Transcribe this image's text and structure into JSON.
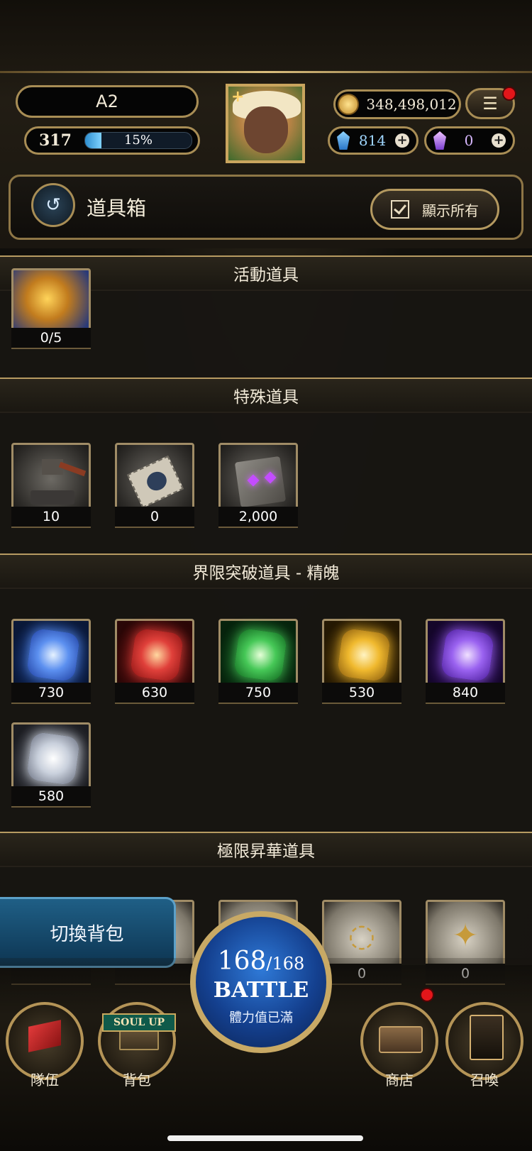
{
  "header": {
    "player_name": "A2",
    "level": "317",
    "exp_percent_label": "15%",
    "exp_fraction": 0.15,
    "gold": "348,498,012",
    "blue_gems": "814",
    "purple_gems": "0",
    "menu_icon": "☰",
    "plus": "+"
  },
  "title_bar": {
    "back_icon": "↺",
    "title": "道具箱",
    "show_all_label": "顯示所有"
  },
  "sections": {
    "event": {
      "title": "活動道具",
      "items": [
        {
          "count": "0/5",
          "icon": "golden-star-orb-icon"
        }
      ]
    },
    "special": {
      "title": "特殊道具",
      "items": [
        {
          "count": "10",
          "icon": "hammer-anvil-icon"
        },
        {
          "count": "0",
          "icon": "ticket-icon"
        },
        {
          "count": "2,000",
          "icon": "stone-cube-icon"
        }
      ]
    },
    "limit_break": {
      "title": "界限突破道具 - 精魄",
      "items": [
        {
          "count": "730",
          "icon": "blue-spirit-crystal-icon",
          "color": "#3f74e0"
        },
        {
          "count": "630",
          "icon": "red-spirit-crystal-icon",
          "color": "#d8322c"
        },
        {
          "count": "750",
          "icon": "green-spirit-crystal-icon",
          "color": "#3cb84a"
        },
        {
          "count": "530",
          "icon": "gold-spirit-crystal-icon",
          "color": "#e0a92a"
        },
        {
          "count": "840",
          "icon": "purple-spirit-crystal-icon",
          "color": "#8a4fe0"
        },
        {
          "count": "580",
          "icon": "white-spirit-crystal-icon",
          "color": "#d9dde6"
        }
      ]
    },
    "ultimate": {
      "title": "極限昇華道具",
      "items": [
        {
          "count": "",
          "icon": "rune-stone-circle-icon"
        },
        {
          "count": "",
          "icon": "rune-stone-crescent-icon"
        },
        {
          "count": "",
          "icon": "rune-stone-leaf-icon"
        },
        {
          "count": "0",
          "icon": "rune-stone-ring-icon"
        },
        {
          "count": "0",
          "icon": "rune-stone-star-icon"
        }
      ]
    }
  },
  "switch_bag_label": "切換背包",
  "nav": {
    "team": "隊伍",
    "bag": "背包",
    "soul_up": "SOUL UP",
    "shop": "商店",
    "summon": "召喚"
  },
  "battle": {
    "stamina_current": "168",
    "stamina_max": "/168",
    "label": "BATTLE",
    "status": "體力值已滿"
  }
}
